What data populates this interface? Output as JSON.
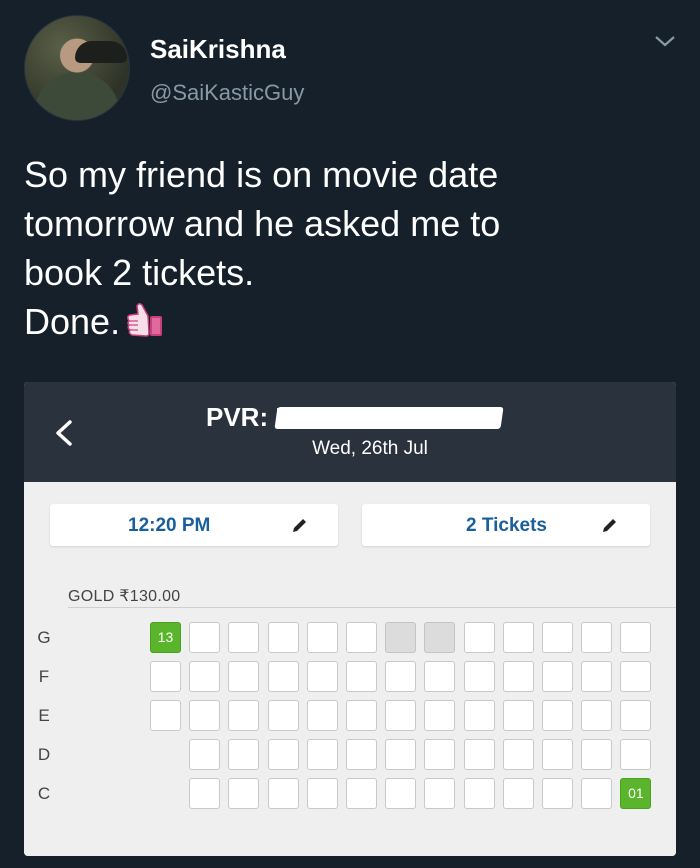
{
  "tweet": {
    "display_name": "SaiKrishna",
    "handle": "@SaiKasticGuy",
    "text_lines": [
      "So my friend is on movie date",
      "tomorrow and he asked me to",
      "book 2 tickets.",
      "Done."
    ],
    "emoji": "thumbs-up-icon"
  },
  "booking": {
    "cinema_title": "PVR: E",
    "date": "Wed, 26th Jul",
    "showtime": "12:20 PM",
    "tickets": "2 Tickets",
    "section_label": "GOLD ₹130.00",
    "rows": [
      {
        "letter": "G",
        "start_col": 0,
        "seats": [
          "sel",
          "avail",
          "avail",
          "avail",
          "avail",
          "avail",
          "taken",
          "taken",
          "avail",
          "avail",
          "avail",
          "avail",
          "avail"
        ],
        "selected_label": "13"
      },
      {
        "letter": "F",
        "start_col": 0,
        "seats": [
          "avail",
          "avail",
          "avail",
          "avail",
          "avail",
          "avail",
          "avail",
          "avail",
          "avail",
          "avail",
          "avail",
          "avail",
          "avail"
        ]
      },
      {
        "letter": "E",
        "start_col": 0,
        "seats": [
          "avail",
          "avail",
          "avail",
          "avail",
          "avail",
          "avail",
          "avail",
          "avail",
          "avail",
          "avail",
          "avail",
          "avail",
          "avail"
        ]
      },
      {
        "letter": "D",
        "start_col": 1,
        "seats": [
          "avail",
          "avail",
          "avail",
          "avail",
          "avail",
          "avail",
          "avail",
          "avail",
          "avail",
          "avail",
          "avail",
          "avail"
        ]
      },
      {
        "letter": "C",
        "start_col": 1,
        "seats": [
          "avail",
          "avail",
          "avail",
          "avail",
          "avail",
          "avail",
          "avail",
          "avail",
          "avail",
          "avail",
          "avail",
          "sel"
        ],
        "selected_label": "01"
      }
    ],
    "colors": {
      "selected": "#5ab52c",
      "taken": "#dcdcdc",
      "app_bar": "#2a323d",
      "link": "#1a5f9c"
    }
  }
}
